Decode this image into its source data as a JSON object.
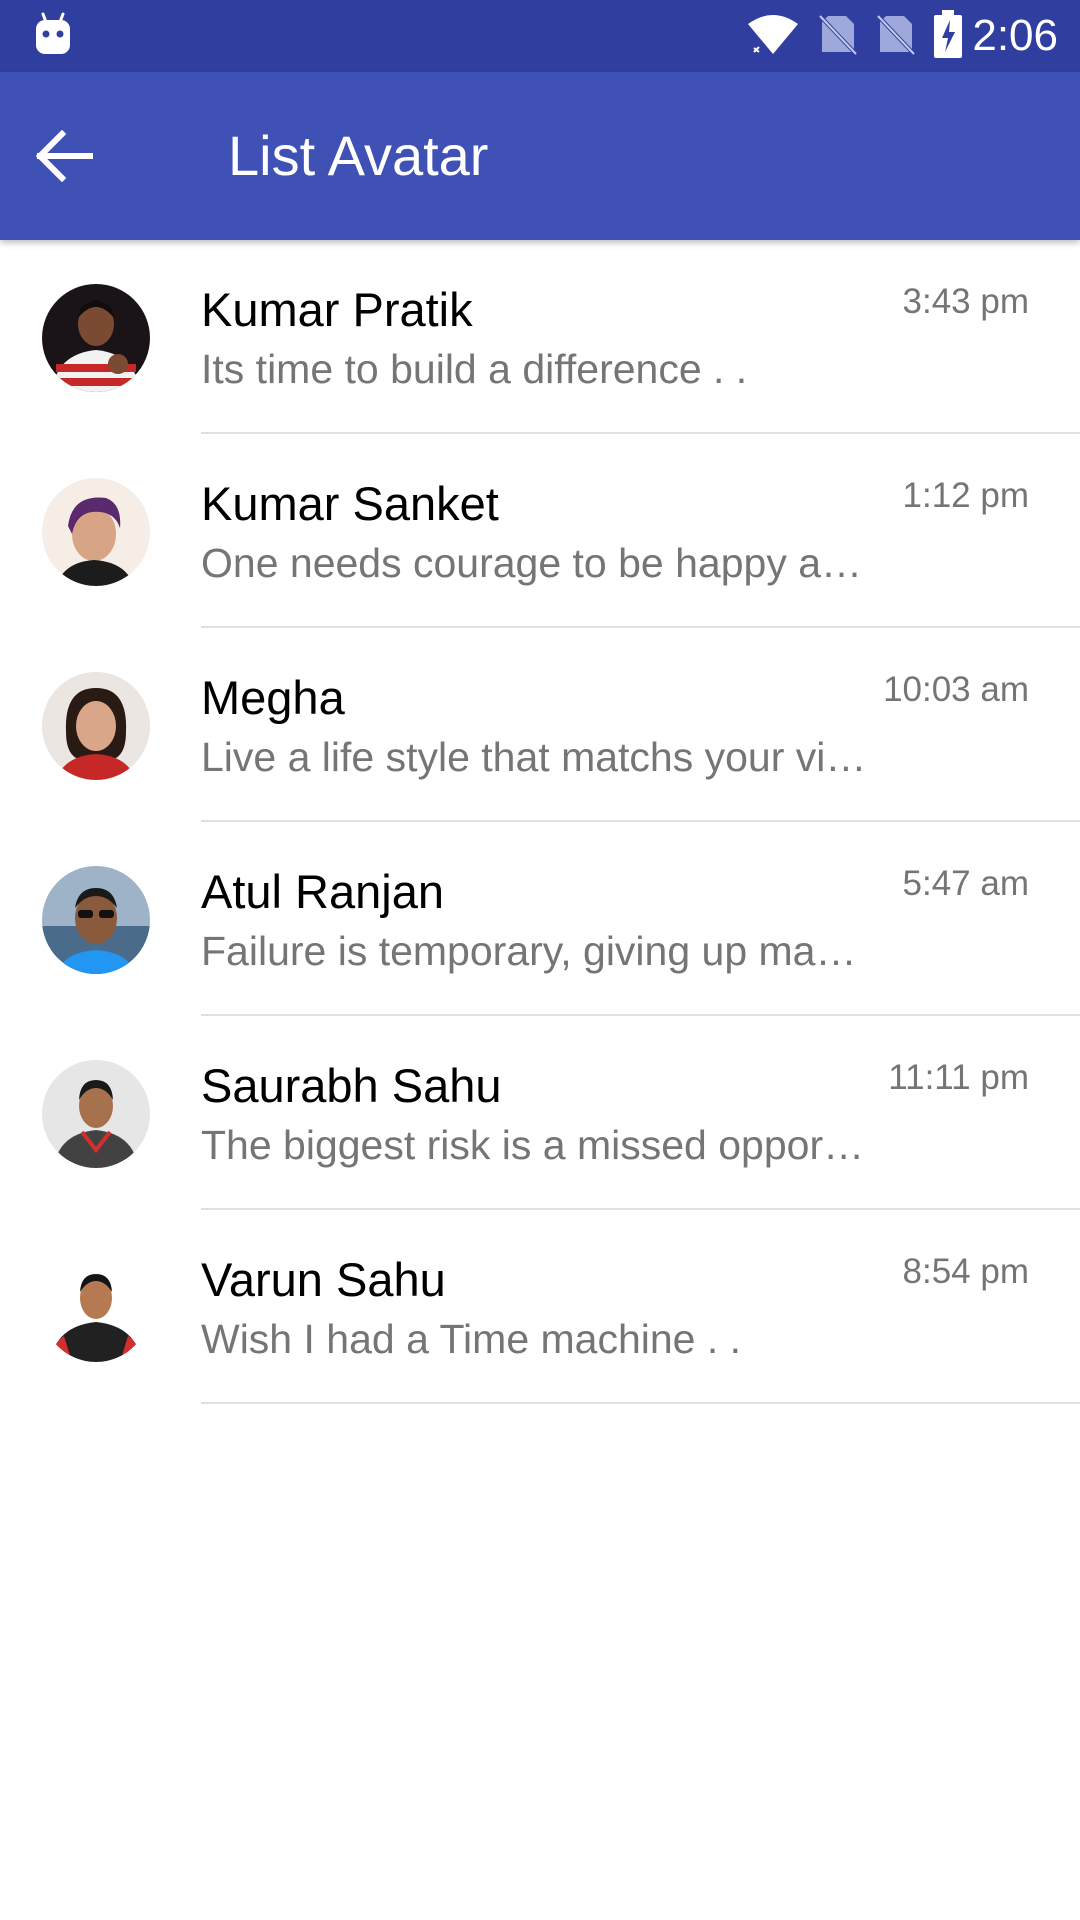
{
  "status_bar": {
    "time": "2:06",
    "icons": [
      "android-icon",
      "wifi-icon",
      "no-sim-icon",
      "no-sim-icon",
      "battery-charging-icon"
    ],
    "color": "#303f9f"
  },
  "app_bar": {
    "title": "List Avatar",
    "back_icon": "arrow-back-icon",
    "color": "#3f51b5"
  },
  "list": {
    "items": [
      {
        "name": "Kumar Pratik",
        "message": "Its time to build a difference . .",
        "time": "3:43 pm",
        "avatar": "avatar-kumar-pratik"
      },
      {
        "name": "Kumar Sanket",
        "message": "One needs courage to be happy and smile all the time",
        "time": "1:12 pm",
        "avatar": "avatar-kumar-sanket"
      },
      {
        "name": "Megha",
        "message": "Live a life style that matchs your vision",
        "time": "10:03 am",
        "avatar": "avatar-megha"
      },
      {
        "name": "Atul Ranjan",
        "message": "Failure is temporary, giving up makes it permanent",
        "time": "5:47 am",
        "avatar": "avatar-atul-ranjan"
      },
      {
        "name": "Saurabh Sahu",
        "message": "The biggest risk is a missed opportunity",
        "time": "11:11 pm",
        "avatar": "avatar-saurabh-sahu"
      },
      {
        "name": "Varun Sahu",
        "message": "Wish I had a Time machine . .",
        "time": "8:54 pm",
        "avatar": "avatar-varun-sahu"
      }
    ]
  }
}
